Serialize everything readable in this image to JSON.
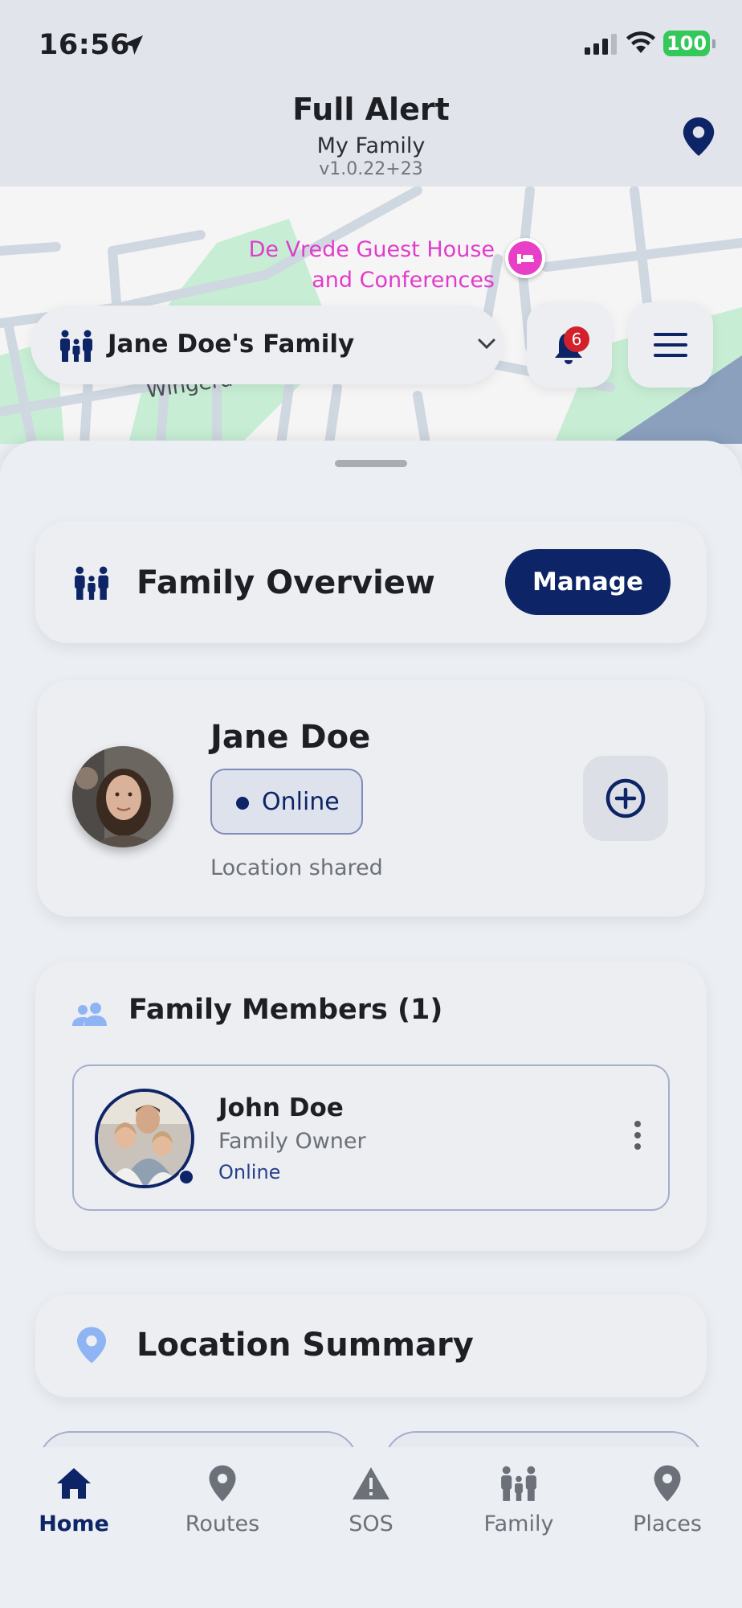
{
  "status_bar": {
    "time": "16:56",
    "battery": "100"
  },
  "header": {
    "title": "Full Alert",
    "subtitle": "My Family",
    "version": "v1.0.22+23"
  },
  "map": {
    "poi_label": "De Vrede Guest House and Conferences",
    "street_label": "Wingerd"
  },
  "family_selector": {
    "label": "Jane Doe's Family"
  },
  "notifications": {
    "count": "6"
  },
  "overview": {
    "title": "Family Overview",
    "manage_label": "Manage"
  },
  "profile": {
    "name": "Jane Doe",
    "status": "Online",
    "location_status": "Location shared"
  },
  "members": {
    "title": "Family Members (1)",
    "items": [
      {
        "name": "John Doe",
        "role": "Family Owner",
        "status": "Online"
      }
    ]
  },
  "location_summary": {
    "title": "Location Summary"
  },
  "bottom_nav": {
    "items": [
      {
        "label": "Home",
        "icon": "home-icon",
        "active": true
      },
      {
        "label": "Routes",
        "icon": "pin-icon",
        "active": false
      },
      {
        "label": "SOS",
        "icon": "warning-icon",
        "active": false
      },
      {
        "label": "Family",
        "icon": "family-icon",
        "active": false
      },
      {
        "label": "Places",
        "icon": "pin-icon",
        "active": false
      }
    ]
  },
  "colors": {
    "primary": "#0d2466",
    "background": "#ebeef2",
    "poi": "#e03ccb",
    "badge": "#d3212c",
    "battery": "#34c759"
  }
}
